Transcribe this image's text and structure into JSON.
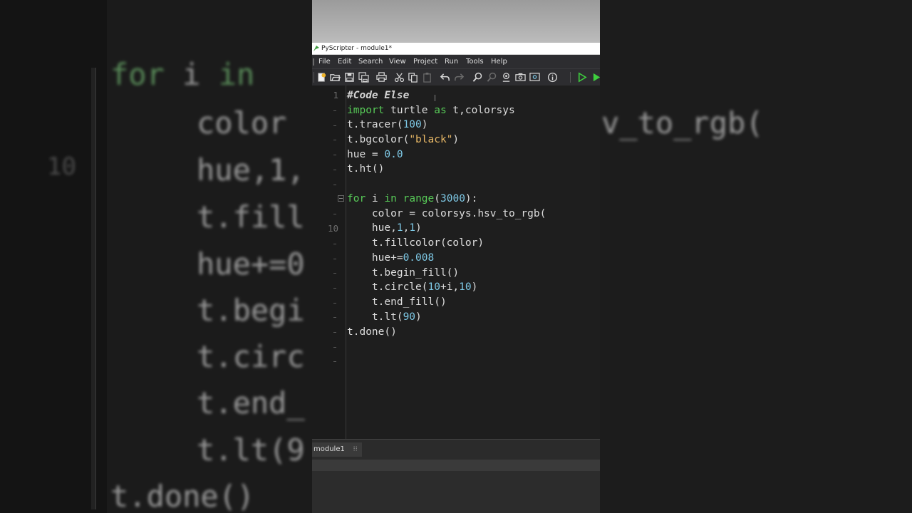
{
  "window": {
    "title": "PyScripter - module1*"
  },
  "menu": [
    "File",
    "Edit",
    "Search",
    "View",
    "Project",
    "Run",
    "Tools",
    "Help"
  ],
  "toolbar": {
    "icons": [
      "new-file-icon",
      "open-folder-icon",
      "save-icon",
      "save-all-icon",
      "print-icon",
      "cut-icon",
      "copy-icon",
      "paste-icon",
      "undo-icon",
      "redo-icon",
      "search-icon",
      "replace-icon",
      "find-in-files-icon",
      "screenshot-icon",
      "view-icon",
      "info-icon",
      "run-icon",
      "debug-icon"
    ]
  },
  "editor": {
    "line_numbers": [
      "1",
      "10"
    ],
    "code": {
      "l1": {
        "comment": "#Code Else"
      },
      "l2": {
        "kw1": "import",
        "p1": " turtle ",
        "kw2": "as",
        "p2": " t,colorsys"
      },
      "l3": {
        "p1": "t.tracer(",
        "n1": "100",
        "p2": ")"
      },
      "l4": {
        "p1": "t.bgcolor(",
        "s1": "\"black\"",
        "p2": ")"
      },
      "l5": {
        "p1": "hue = ",
        "n1": "0.0"
      },
      "l6": {
        "p1": "t.ht()"
      },
      "l8": {
        "kw1": "for",
        "p1": " i ",
        "kw2": "in",
        "p2": " ",
        "kw3": "range",
        "p3": "(",
        "n1": "3000",
        "p4": "):"
      },
      "l9": {
        "p1": "    color = colorsys.hsv_to_rgb("
      },
      "l10": {
        "p1": "    hue,",
        "n1": "1",
        "p2": ",",
        "n2": "1",
        "p3": ")"
      },
      "l11": {
        "p1": "    t.fillcolor(color)"
      },
      "l12": {
        "p1": "    hue+=",
        "n1": "0.008"
      },
      "l13": {
        "p1": "    t.begin_fill()"
      },
      "l14": {
        "p1": "    t.circle(",
        "n1": "10",
        "p2": "+i,",
        "n2": "10",
        "p3": ")"
      },
      "l15": {
        "p1": "    t.end_fill()"
      },
      "l16": {
        "p1": "    t.lt(",
        "n1": "90",
        "p2": ")"
      },
      "l17": {
        "p1": "t.done()"
      }
    }
  },
  "tabs": [
    {
      "label": "module1"
    }
  ],
  "background": {
    "left_lines": [
      "for i in ",
      "color ",
      "hue,1,",
      "t.fill",
      "hue+=0",
      "t.begi",
      "t.circ",
      "t.end_",
      "t.lt(9",
      "t.done()"
    ],
    "left_number": "10",
    "right_line": "v_to_rgb("
  }
}
